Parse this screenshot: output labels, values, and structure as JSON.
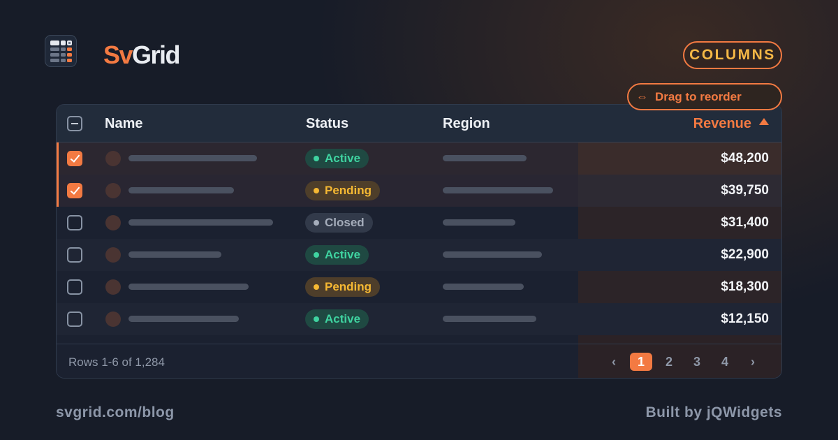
{
  "brand": {
    "part1": "Sv",
    "part2": "Grid",
    "logo_icon": "calculator-grid-icon"
  },
  "toolbar": {
    "columns_label": "COLUMNS",
    "drag_hint": "Drag to reorder",
    "drag_icon": "left-right-arrow-icon"
  },
  "grid": {
    "columns": {
      "name": "Name",
      "status": "Status",
      "region": "Region",
      "revenue": "Revenue"
    },
    "sort": {
      "column": "Revenue",
      "direction": "ascending-indicator"
    },
    "rows": [
      {
        "selected": true,
        "status": "Active",
        "revenue": "$48,200"
      },
      {
        "selected": true,
        "status": "Pending",
        "revenue": "$39,750"
      },
      {
        "selected": false,
        "status": "Closed",
        "revenue": "$31,400"
      },
      {
        "selected": false,
        "status": "Active",
        "revenue": "$22,900"
      },
      {
        "selected": false,
        "status": "Pending",
        "revenue": "$18,300"
      },
      {
        "selected": false,
        "status": "Active",
        "revenue": "$12,150"
      }
    ],
    "footer": {
      "row_info": "Rows 1-6 of 1,284",
      "prev": "‹",
      "pages": [
        "1",
        "2",
        "3",
        "4"
      ],
      "current_page": "1",
      "next": "›"
    }
  },
  "bottom": {
    "left": "svgrid.com/blog",
    "right": "Built by jQWidgets"
  },
  "colors": {
    "accent": "#f37a42",
    "active": "#3fd3a0",
    "pending": "#f5b833",
    "closed": "#a5adbb",
    "background": "#171c28"
  }
}
